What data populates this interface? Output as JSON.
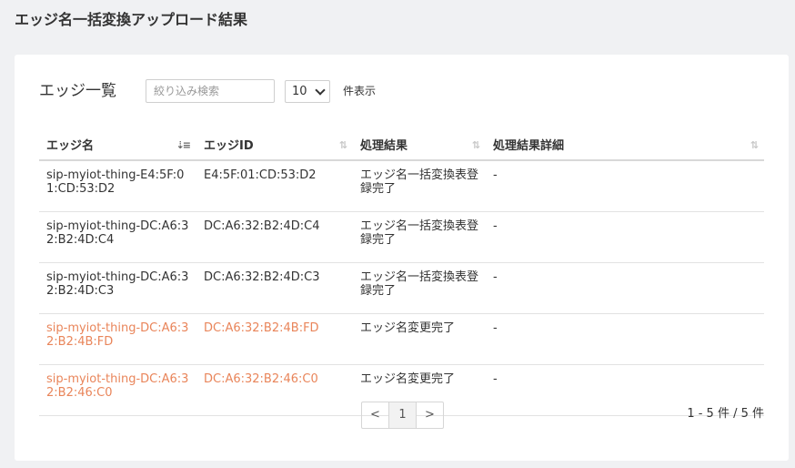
{
  "page": {
    "title": "エッジ名一括変換アップロード結果"
  },
  "list": {
    "title": "エッジ一覧",
    "search_placeholder": "絞り込み検索",
    "page_size": "10",
    "page_size_suffix": "件表示"
  },
  "table": {
    "headers": [
      "エッジ名",
      "エッジID",
      "処理結果",
      "処理結果詳細"
    ],
    "rows": [
      {
        "name": "sip-myiot-thing-E4:5F:01:CD:53:D2",
        "id": "E4:5F:01:CD:53:D2",
        "result": "エッジ名一括変換表登録完了",
        "detail": "-",
        "highlight": false
      },
      {
        "name": "sip-myiot-thing-DC:A6:32:B2:4D:C4",
        "id": "DC:A6:32:B2:4D:C4",
        "result": "エッジ名一括変換表登録完了",
        "detail": "-",
        "highlight": false
      },
      {
        "name": "sip-myiot-thing-DC:A6:32:B2:4D:C3",
        "id": "DC:A6:32:B2:4D:C3",
        "result": "エッジ名一括変換表登録完了",
        "detail": "-",
        "highlight": false
      },
      {
        "name": "sip-myiot-thing-DC:A6:32:B2:4B:FD",
        "id": "DC:A6:32:B2:4B:FD",
        "result": "エッジ名変更完了",
        "detail": "-",
        "highlight": true
      },
      {
        "name": "sip-myiot-thing-DC:A6:32:B2:46:C0",
        "id": "DC:A6:32:B2:46:C0",
        "result": "エッジ名変更完了",
        "detail": "-",
        "highlight": true
      }
    ],
    "highlight_color": "#e9855a"
  },
  "pagination": {
    "prev": "<",
    "current": "1",
    "next": ">",
    "range": "1 - 5 件 / 5 件"
  }
}
